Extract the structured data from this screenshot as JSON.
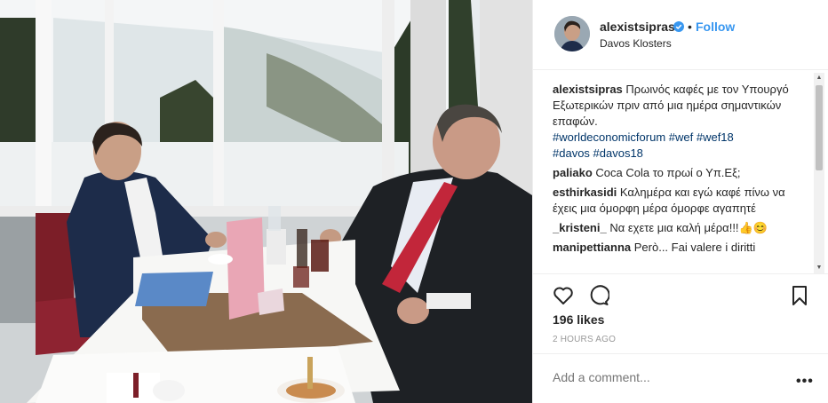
{
  "post": {
    "username": "alexistsipras",
    "follow_label": "Follow",
    "separator": "•",
    "location": "Davos Klosters",
    "likes": "196 likes",
    "time_ago": "2 HOURS AGO",
    "add_comment_placeholder": "Add a comment...",
    "more_label": "•••"
  },
  "caption": {
    "user": "alexistsipras",
    "text": "Πρωινός καφές με τον Υπουργό Εξωτερικών πριν από μια ημέρα σημαντικών επαφών.",
    "hashtags_line1": "#worldeconomicforum #wef #wef18",
    "hashtags_line2": "#davos #davos18"
  },
  "comments": [
    {
      "user": "paliako",
      "text": "Coca Cola το πρωί ο Υπ.Εξ;"
    },
    {
      "user": "esthirkasidi",
      "text": "Καλημέρα και εγώ καφέ πίνω να έχεις μια όμορφη μέρα όμορφε αγαπητέ"
    },
    {
      "user": "_kristeni_",
      "text": "Να εχετε μια καλή μέρα!!!👍😊"
    },
    {
      "user": "manipettianna",
      "text": "Però... Fai valere i diritti"
    }
  ],
  "icons": {
    "verified": "verified-badge-icon",
    "like": "heart-icon",
    "comment": "comment-bubble-icon",
    "save": "bookmark-icon"
  },
  "colors": {
    "link_blue": "#3897f0",
    "hashtag": "#003569",
    "text": "#262626",
    "muted": "#999999"
  }
}
